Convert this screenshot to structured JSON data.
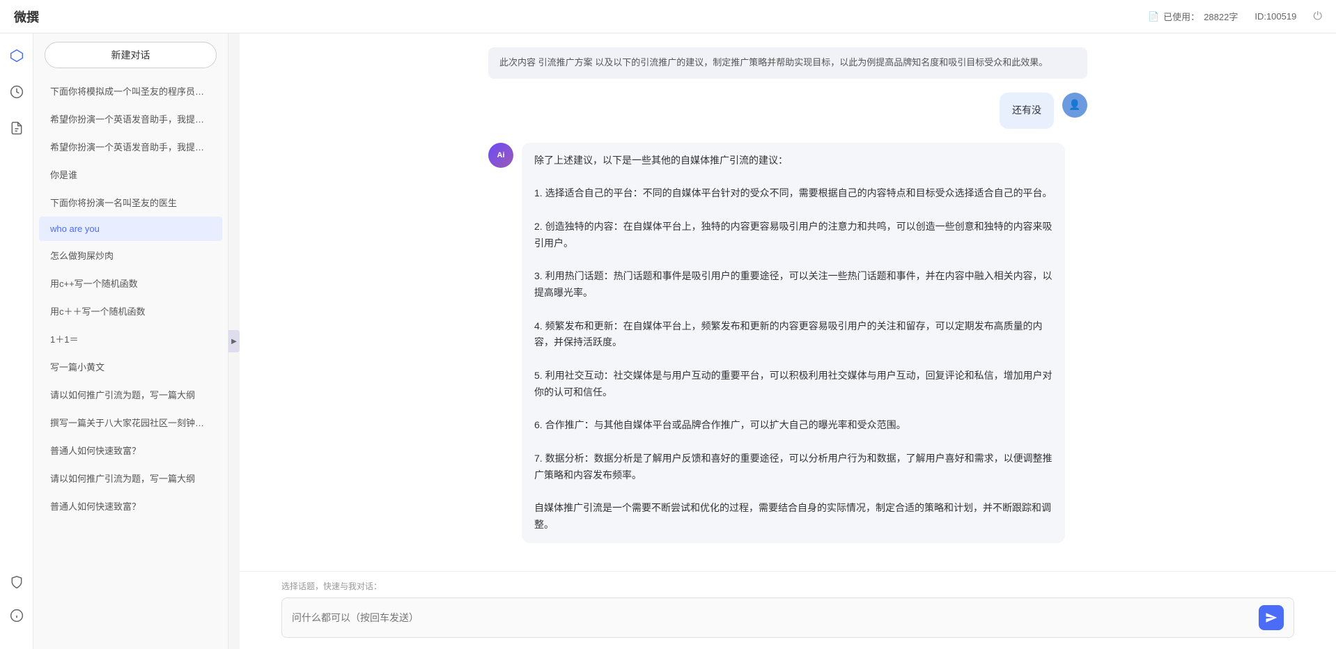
{
  "app": {
    "title": "微撰",
    "usage_label": "已使用：",
    "usage_value": "28822字",
    "id_label": "ID:100519"
  },
  "sidebar": {
    "icons": [
      {
        "name": "hexagon-icon",
        "symbol": "⬡",
        "active": true
      },
      {
        "name": "clock-icon",
        "symbol": "⏰"
      },
      {
        "name": "file-icon",
        "symbol": "📄"
      }
    ],
    "bottom_icons": [
      {
        "name": "shield-icon",
        "symbol": "🛡"
      },
      {
        "name": "info-icon",
        "symbol": "ℹ"
      }
    ]
  },
  "new_chat_btn": "新建对话",
  "chat_history": [
    {
      "id": 1,
      "text": "下面你将模拟成一个叫圣友的程序员，我说...",
      "active": false
    },
    {
      "id": 2,
      "text": "希望你扮演一个英语发音助手，我提供给你...",
      "active": false
    },
    {
      "id": 3,
      "text": "希望你扮演一个英语发音助手，我提供给你...",
      "active": false
    },
    {
      "id": 4,
      "text": "你是谁",
      "active": false
    },
    {
      "id": 5,
      "text": "下面你将扮演一名叫圣友的医生",
      "active": false
    },
    {
      "id": 6,
      "text": "who are you",
      "active": true
    },
    {
      "id": 7,
      "text": "怎么做狗屎炒肉",
      "active": false
    },
    {
      "id": 8,
      "text": "用c++写一个随机函数",
      "active": false
    },
    {
      "id": 9,
      "text": "用c＋＋写一个随机函数",
      "active": false
    },
    {
      "id": 10,
      "text": "1＋1＝",
      "active": false
    },
    {
      "id": 11,
      "text": "写一篇小黄文",
      "active": false
    },
    {
      "id": 12,
      "text": "请以如何推广引流为题，写一篇大纲",
      "active": false
    },
    {
      "id": 13,
      "text": "撰写一篇关于八大家花园社区一刻钟便民生...",
      "active": false
    },
    {
      "id": 14,
      "text": "普通人如何快速致富？",
      "active": false
    },
    {
      "id": 15,
      "text": "请以如何推广引流为题，写一篇大纲",
      "active": false
    },
    {
      "id": 16,
      "text": "普通人如何快速致富？",
      "active": false
    }
  ],
  "messages": [
    {
      "role": "previous",
      "content": "此次内容  引流推广方案  以及以下的引流推广的建议，制定推广策略并帮助实现目标，以此为例提高品牌知名度和吸引目标受众和此效果。"
    },
    {
      "role": "user",
      "content": "还有没"
    },
    {
      "role": "ai",
      "content": "除了上述建议，以下是一些其他的自媒体推广引流的建议：\n\n1. 选择适合自己的平台：不同的自媒体平台针对的受众不同，需要根据自己的内容特点和目标受众选择适合自己的平台。\n\n2. 创造独特的内容：在自媒体平台上，独特的内容更容易吸引用户的注意力和共鸣，可以创造一些创意和独特的内容来吸引用户。\n\n3. 利用热门话题：热门话题和事件是吸引用户的重要途径，可以关注一些热门话题和事件，并在内容中融入相关内容，以提高曝光率。\n\n4. 频繁发布和更新：在自媒体平台上，频繁发布和更新的内容更容易吸引用户的关注和留存，可以定期发布高质量的内容，并保持活跃度。\n\n5. 利用社交互动：社交媒体是与用户互动的重要平台，可以积极利用社交媒体与用户互动，回复评论和私信，增加用户对你的认可和信任。\n\n6. 合作推广：与其他自媒体平台或品牌合作推广，可以扩大自己的曝光率和受众范围。\n\n7. 数据分析：数据分析是了解用户反馈和喜好的重要途径，可以分析用户行为和数据，了解用户喜好和需求，以便调整推广策略和内容发布频率。\n\n自媒体推广引流是一个需要不断尝试和优化的过程，需要结合自身的实际情况，制定合适的策略和计划，并不断跟踪和调整。"
    }
  ],
  "input": {
    "quick_topics_label": "选择话题，快速与我对话：",
    "placeholder": "问什么都可以（按回车发送）"
  },
  "send_button_label": "发送"
}
